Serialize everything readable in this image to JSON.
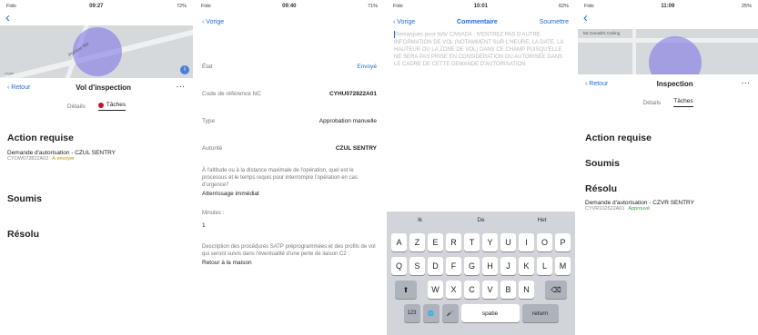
{
  "s1": {
    "time": "09:27",
    "carrier": "Fido",
    "battery": "72%",
    "map_road": "Preston Rd",
    "map_legal": "Légal",
    "back": "Retour",
    "title": "Vol d'inspection",
    "more": "···",
    "tab_details": "Détails",
    "tab_tasks": "Tâches",
    "action_title": "Action requise",
    "request_line": "Demande d'autorisation  -  CZUL SENTRY",
    "request_code": "CYOW072822A02",
    "request_status": "À envoyer",
    "submitted": "Soumis",
    "resolved": "Résolu"
  },
  "s2": {
    "time": "09:40",
    "carrier": "Fido",
    "battery": "71%",
    "back": "Vorige",
    "state_label": "État",
    "state_value": "Envoyé",
    "ref_label": "Code de référence NC",
    "ref_value": "CYHU072822A01",
    "type_label": "Type",
    "type_value": "Approbation manuelle",
    "authority_label": "Autorité",
    "authority_value": "CZUL SENTRY",
    "q1": "À l'altitude ou à la distance maximale de l'opération, quel est le processus et le temps requis pour interrompre l'opération en cas d'urgence?",
    "a1": "Atterrissage immédiat",
    "minutes_label": "Minutes :",
    "minutes_value": "1",
    "q2": "Description des procédures SATP préprogrammées et des profils de vol qui seront suivis dans l'éventualité d'une perte de liaison C2 :",
    "a2": "Retour à la maison"
  },
  "s3": {
    "time": "10:01",
    "carrier": "Fido",
    "battery": "62%",
    "back": "Vorige",
    "title": "Commentaire",
    "submit": "Soumettre",
    "placeholder": "Remarques pour NAV CANADA : N'ENTREZ PAS D'AUTRE INFORMATION DE VOL (NOTAMMENT SUR L'HEURE, LA DATE, LA HAUTEUR OU LA ZONE DE VOL) DANS CE CHAMP PUISQU'ELLE NE SERA PAS PRISE EN CONSIDÉRATION OU AUTORISÉE DANS LE CADRE DE CETTE DEMANDE D'AUTORISATION",
    "suggestions": [
      "Ik",
      "De",
      "Het"
    ],
    "row1": [
      "A",
      "Z",
      "E",
      "R",
      "T",
      "Y",
      "U",
      "I",
      "O",
      "P"
    ],
    "row2": [
      "Q",
      "S",
      "D",
      "F",
      "G",
      "H",
      "J",
      "K",
      "L",
      "M"
    ],
    "row3": [
      "W",
      "X",
      "C",
      "V",
      "B",
      "N"
    ],
    "shift": "⬆",
    "backspace": "⌫",
    "num": "123",
    "globe": "🌐",
    "mic": "🎤",
    "space": "spatie",
    "return": "return"
  },
  "s4": {
    "time": "11:09",
    "carrier": "Fido",
    "battery": "25%",
    "map_road": "Mc Donald's Carling",
    "back": "Retour",
    "title": "Inspection",
    "more": "···",
    "tab_details": "Détails",
    "tab_tasks": "Tâches",
    "action_title": "Action requise",
    "submitted": "Soumis",
    "resolved": "Résolu",
    "request_line": "Demande d'autorisation  -  CZVR SENTRY",
    "request_code": "CYVR102522A01",
    "request_status": "Approuvé"
  }
}
